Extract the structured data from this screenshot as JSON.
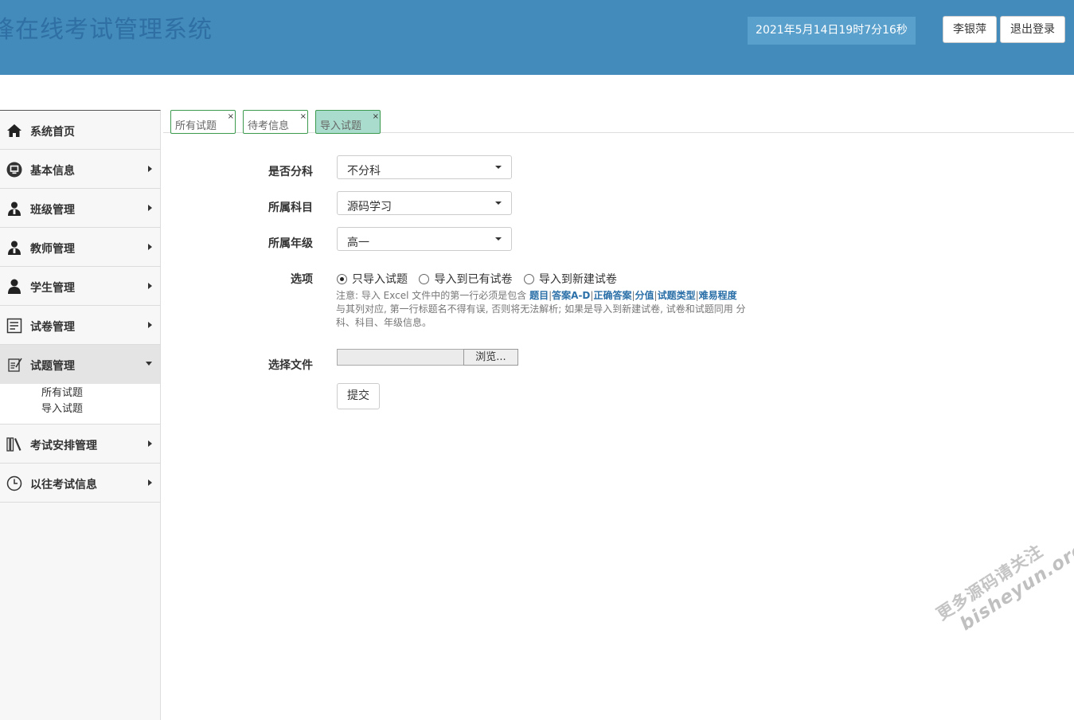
{
  "header": {
    "app_title": "锋在线考试管理系统",
    "datetime": "2021年5月14日19时7分16秒",
    "user_name": "李银萍",
    "logout_label": "退出登录"
  },
  "sidebar": {
    "items": [
      {
        "label": "系统首页",
        "icon": "home-icon"
      },
      {
        "label": "基本信息",
        "icon": "monitor-icon"
      },
      {
        "label": "班级管理",
        "icon": "class-user-icon"
      },
      {
        "label": "教师管理",
        "icon": "teacher-icon"
      },
      {
        "label": "学生管理",
        "icon": "student-icon"
      },
      {
        "label": "试卷管理",
        "icon": "paper-icon"
      },
      {
        "label": "试题管理",
        "icon": "question-icon"
      },
      {
        "label": "考试安排管理",
        "icon": "books-icon"
      },
      {
        "label": "以往考试信息",
        "icon": "clock-icon"
      }
    ],
    "subitems": [
      "所有试题",
      "导入试题"
    ]
  },
  "tabs": [
    {
      "label": "所有试题",
      "close": "×"
    },
    {
      "label": "待考信息",
      "close": "×"
    },
    {
      "label": "导入试题",
      "close": "×"
    }
  ],
  "form": {
    "subject_split_label": "是否分科",
    "subject_split_value": "不分科",
    "subject_label": "所属科目",
    "subject_value": "源码学习",
    "grade_label": "所属年级",
    "grade_value": "高一",
    "options_label": "选项",
    "options": [
      "只导入试题",
      "导入到已有试卷",
      "导入到新建试卷"
    ],
    "selected_option": 0,
    "note_prefix": "注意: 导入 Excel 文件中的第一行必须是包含 ",
    "note_fields": [
      "题目",
      "答案A-D",
      "正确答案",
      "分值",
      "试题类型",
      "难易程度"
    ],
    "note_suffix": " 与其列对应, 第一行标题名不得有误, 否则将无法解析; 如果是导入到新建试卷, 试卷和试题同用 分科、科目、年级信息。",
    "file_label": "选择文件",
    "browse_label": "浏览...",
    "submit_label": "提交"
  },
  "watermark": {
    "line1": "更多源码请关注",
    "line2": "bisheyun.org"
  }
}
